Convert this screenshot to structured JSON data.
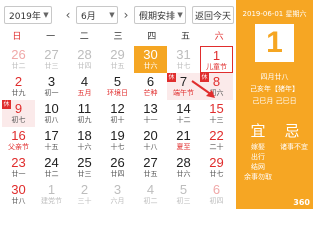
{
  "toolbar": {
    "year": "2019年",
    "month": "6月",
    "holiday_select": "假期安排",
    "today_button": "返回今天",
    "prev_arrow": "‹",
    "next_arrow": "›"
  },
  "weekdays": [
    "日",
    "一",
    "二",
    "三",
    "四",
    "五",
    "六"
  ],
  "weeks": [
    [
      {
        "day": "26",
        "sub": "廿二",
        "other": true,
        "we": true
      },
      {
        "day": "27",
        "sub": "廿三",
        "other": true
      },
      {
        "day": "28",
        "sub": "廿四",
        "other": true
      },
      {
        "day": "29",
        "sub": "廿五",
        "other": true
      },
      {
        "day": "30",
        "sub": "廿六",
        "today": true
      },
      {
        "day": "31",
        "sub": "廿七",
        "other": true
      },
      {
        "day": "1",
        "sub": "儿童节",
        "we": true,
        "selected": true,
        "fest": true
      }
    ],
    [
      {
        "day": "2",
        "sub": "廿九",
        "we": true
      },
      {
        "day": "3",
        "sub": "初一"
      },
      {
        "day": "4",
        "sub": "五月",
        "fest": true
      },
      {
        "day": "5",
        "sub": "环境日",
        "fest": true
      },
      {
        "day": "6",
        "sub": "芒种",
        "fest": true
      },
      {
        "day": "7",
        "sub": "端午节",
        "fest": true,
        "holiday": true,
        "badge": "休"
      },
      {
        "day": "8",
        "sub": "初六",
        "we": true,
        "holiday": true,
        "badge": "休"
      }
    ],
    [
      {
        "day": "9",
        "sub": "初七",
        "we": true,
        "holiday": true,
        "badge": "休"
      },
      {
        "day": "10",
        "sub": "初八"
      },
      {
        "day": "11",
        "sub": "初九"
      },
      {
        "day": "12",
        "sub": "初十"
      },
      {
        "day": "13",
        "sub": "十一"
      },
      {
        "day": "14",
        "sub": "十二"
      },
      {
        "day": "15",
        "sub": "十三",
        "we": true
      }
    ],
    [
      {
        "day": "16",
        "sub": "父亲节",
        "we": true,
        "fest": true
      },
      {
        "day": "17",
        "sub": "十五"
      },
      {
        "day": "18",
        "sub": "十六"
      },
      {
        "day": "19",
        "sub": "十七"
      },
      {
        "day": "20",
        "sub": "十八"
      },
      {
        "day": "21",
        "sub": "夏至",
        "fest": true
      },
      {
        "day": "22",
        "sub": "二十",
        "we": true
      }
    ],
    [
      {
        "day": "23",
        "sub": "廿一",
        "we": true
      },
      {
        "day": "24",
        "sub": "廿二"
      },
      {
        "day": "25",
        "sub": "廿三"
      },
      {
        "day": "26",
        "sub": "廿四"
      },
      {
        "day": "27",
        "sub": "廿五"
      },
      {
        "day": "28",
        "sub": "廿六"
      },
      {
        "day": "29",
        "sub": "廿七",
        "we": true
      }
    ],
    [
      {
        "day": "30",
        "sub": "廿八",
        "we": true
      },
      {
        "day": "1",
        "sub": "建党节",
        "other": true
      },
      {
        "day": "2",
        "sub": "三十",
        "other": true
      },
      {
        "day": "3",
        "sub": "六月",
        "other": true
      },
      {
        "day": "4",
        "sub": "初二",
        "other": true
      },
      {
        "day": "5",
        "sub": "初三",
        "other": true
      },
      {
        "day": "6",
        "sub": "初四",
        "other": true,
        "we": true
      }
    ]
  ],
  "side": {
    "date": "2019-06-01 星期六",
    "big_day": "1",
    "lunar": "四月廿八",
    "ganzhi_year": "己亥年【猪年】",
    "ganzhi_day": "己巳月 己巳日",
    "yi_label": "宜",
    "ji_label": "忌",
    "yi_items": [
      "嫁娶",
      "出行",
      "结网",
      "余事勿取"
    ],
    "ji_items": [
      "诸事不宜"
    ],
    "logo": "360"
  },
  "colors": {
    "accent": "#f5a623",
    "weekend_red": "#e02d2d",
    "holiday_bg": "#fbeaea"
  }
}
